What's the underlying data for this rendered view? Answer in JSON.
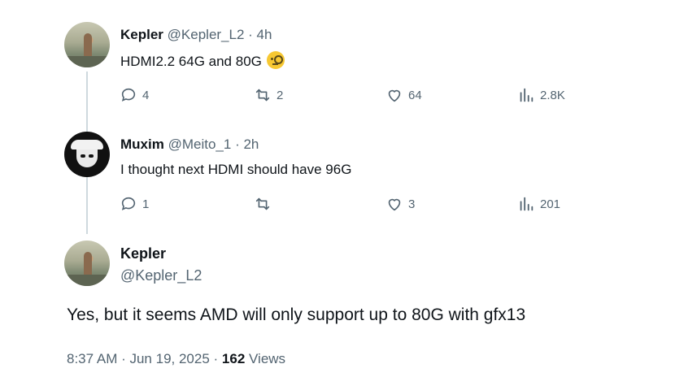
{
  "tweet1": {
    "name": "Kepler",
    "handle": "@Kepler_L2",
    "time": "· 4h",
    "text": "HDMI2.2 64G and 80G",
    "emoji": "face-with-monocle",
    "replies": "4",
    "retweets": "2",
    "likes": "64",
    "views": "2.8K"
  },
  "tweet2": {
    "name": "Muxim",
    "handle": "@Meito_1",
    "time": "· 2h",
    "text": "I thought next HDMI should have 96G",
    "replies": "1",
    "retweets": "",
    "likes": "3",
    "views": "201"
  },
  "main_tweet": {
    "name": "Kepler",
    "handle": "@Kepler_L2",
    "text": "Yes, but it seems AMD will only support up to 80G with gfx13",
    "timestamp": "8:37 AM · Jun 19, 2025 ·",
    "view_count": "162",
    "views_label": "Views"
  },
  "icons": {
    "reply": "reply-icon",
    "retweet": "retweet-icon",
    "like": "heart-icon",
    "views": "views-icon"
  },
  "colors": {
    "text": "#0f1419",
    "secondary": "#536471",
    "thread_line": "#cfd9de"
  }
}
